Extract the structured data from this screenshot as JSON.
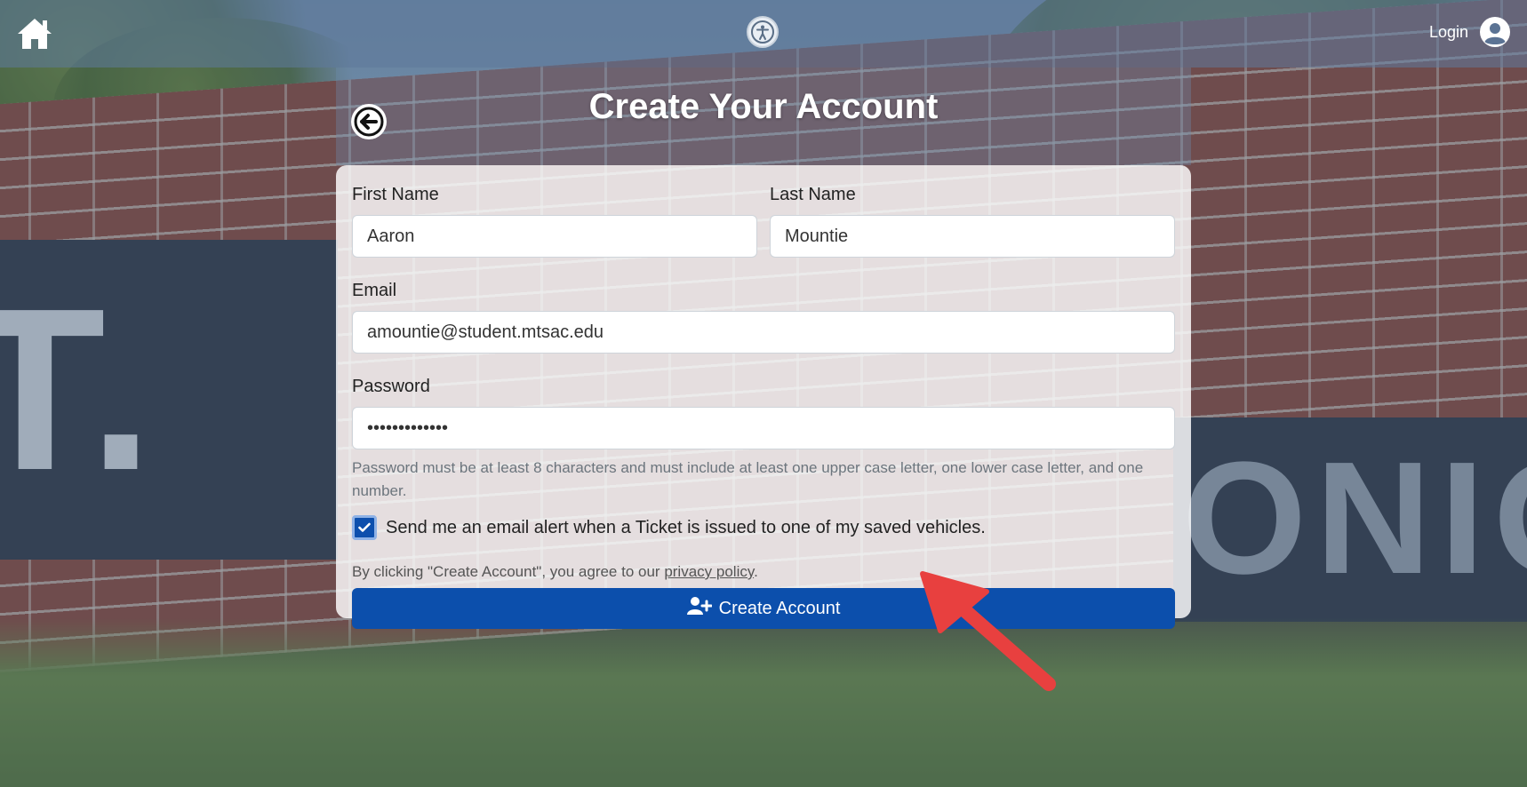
{
  "nav": {
    "home_icon": "home-icon",
    "accessibility_icon": "accessibility-icon",
    "login_label": "Login",
    "avatar_icon": "user-circle-icon"
  },
  "page": {
    "title": "Create Your Account",
    "back_icon": "arrow-left-circle-icon"
  },
  "form": {
    "first_name": {
      "label": "First Name",
      "value": "Aaron"
    },
    "last_name": {
      "label": "Last Name",
      "value": "Mountie"
    },
    "email": {
      "label": "Email",
      "value": "amountie@student.mtsac.edu"
    },
    "password": {
      "label": "Password",
      "value": "•••••••••••••"
    },
    "password_hint": "Password must be at least 8 characters and must include at least one upper case letter, one lower case letter, and one number.",
    "email_alert": {
      "checked": true,
      "label": "Send me an email alert when a Ticket is issued to one of my saved vehicles."
    },
    "agree_prefix": "By clicking \"Create Account\", you agree to our ",
    "privacy_link": "privacy policy",
    "agree_suffix": ".",
    "submit_label": "Create Account",
    "submit_icon": "user-plus-icon"
  },
  "colors": {
    "primary": "#0c4fac",
    "annotation_arrow": "#e8403f"
  }
}
